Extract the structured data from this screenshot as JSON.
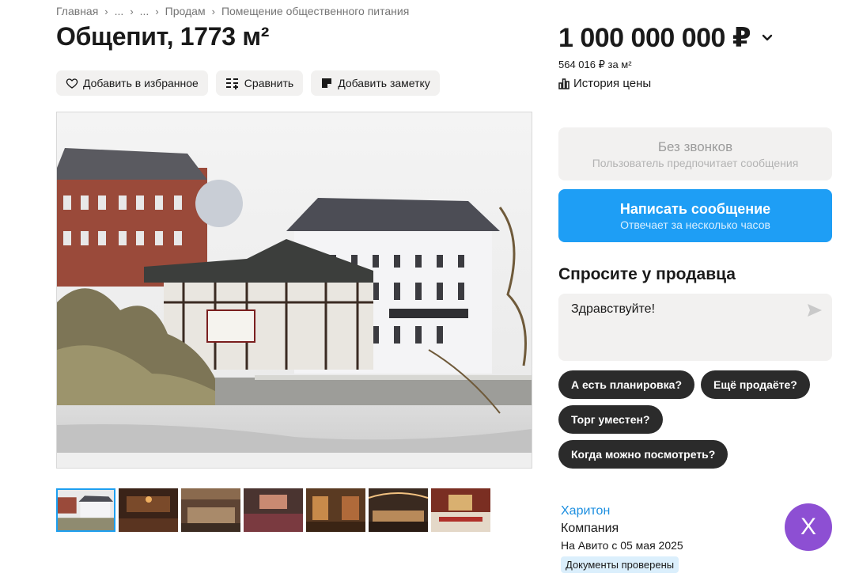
{
  "breadcrumb": {
    "items": [
      "Главная",
      "...",
      "...",
      "Продам",
      "Помещение общественного питания"
    ],
    "separator": "›"
  },
  "listing": {
    "title": "Общепит, 1773 м²",
    "price": "1 000 000 000 ₽",
    "price_per_m": "564 016 ₽ за м²",
    "price_history": "История цены"
  },
  "actions": {
    "favorite": "Добавить в избранное",
    "compare": "Сравнить",
    "note": "Добавить заметку"
  },
  "gallery": {
    "thumbnail_count": 7,
    "active_index": 0
  },
  "contact": {
    "no_calls_title": "Без звонков",
    "no_calls_subtitle": "Пользователь предпочитает сообщения",
    "write_title": "Написать сообщение",
    "write_subtitle": "Отвечает за несколько часов"
  },
  "ask": {
    "title": "Спросите у продавца",
    "message_value": "Здравствуйте!",
    "chips": [
      "А есть планировка?",
      "Ещё продаёте?",
      "Торг уместен?",
      "Когда можно посмотреть?"
    ]
  },
  "seller": {
    "name": "Харитон",
    "type": "Компания",
    "since": "На Авито с 05 мая 2025",
    "badge": "Документы проверены",
    "avatar_letter": "Х"
  },
  "colors": {
    "accent_blue": "#1e9ef5",
    "chip_dark": "#2b2b2b",
    "avatar_purple": "#8d4fd3",
    "button_gray": "#f2f1f0"
  }
}
